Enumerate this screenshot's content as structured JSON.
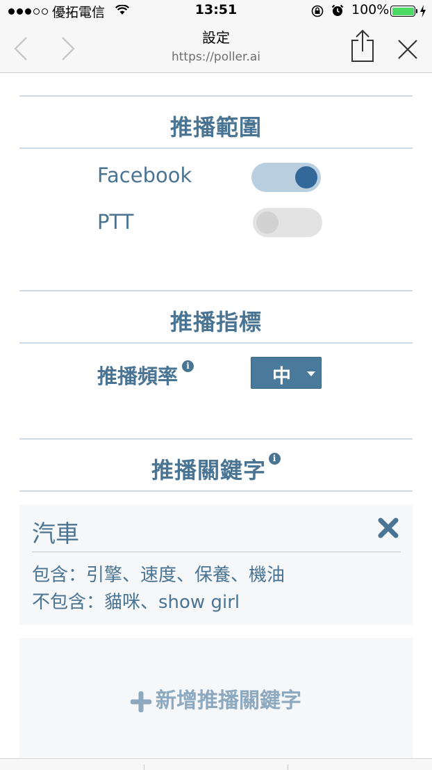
{
  "status_bar": {
    "carrier": "優拓電信",
    "time": "13:51",
    "battery": "100%"
  },
  "nav": {
    "title": "設定",
    "url": "https://poller.ai"
  },
  "sections": {
    "range_title": "推播範圍",
    "metric_title": "推播指標",
    "keyword_title": "推播關鍵字"
  },
  "range": {
    "facebook_label": "Facebook",
    "facebook_on": true,
    "ptt_label": "PTT",
    "ptt_on": false
  },
  "metric": {
    "frequency_label": "推播頻率",
    "frequency_value": "中"
  },
  "keyword_card": {
    "title": "汽車",
    "include": "包含：引擎、速度、保養、機油",
    "exclude": "不包含：貓咪、show girl"
  },
  "add_keyword_label": "新增推播關鍵字",
  "colors": {
    "accent": "#4a7493",
    "toggle_on": "#33689a",
    "toggle_track_on": "#b9cfe0",
    "toggle_track_off": "#e3e3e3",
    "battery": "#4cd964"
  },
  "icons": {
    "back": "chevron-left-icon",
    "forward": "chevron-right-icon",
    "share": "share-icon",
    "close": "close-icon",
    "info": "info-icon",
    "remove": "x-icon",
    "add": "plus-icon"
  }
}
